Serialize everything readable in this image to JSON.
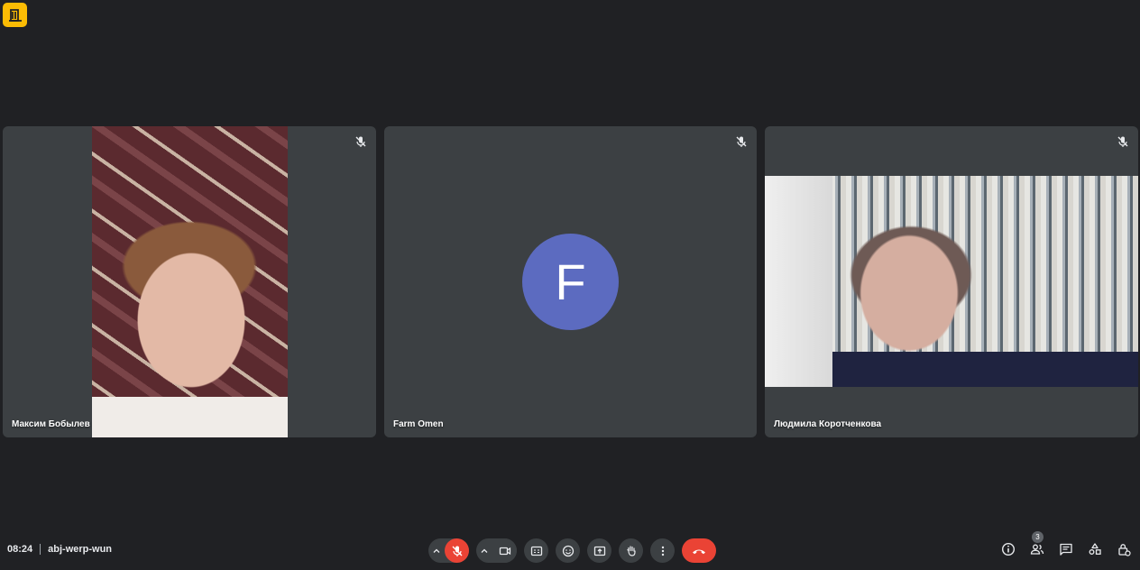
{
  "participants": [
    {
      "name": "Максим Бобылев",
      "mic": "muted"
    },
    {
      "name": "Farm Omen",
      "mic": "muted",
      "avatar_letter": "F",
      "avatar_color": "#5c6bc0"
    },
    {
      "name": "Людмила Коротченкова",
      "mic": "muted"
    }
  ],
  "meeting": {
    "time": "08:24",
    "code": "abj-werp-wun"
  },
  "toolbar": {
    "icons": [
      "chevron-up-icon",
      "mic-off-icon",
      "chevron-up-icon",
      "videocam-icon",
      "captions-icon",
      "emoji-icon",
      "present-icon",
      "raise-hand-icon",
      "more-options-icon",
      "hang-up-icon"
    ]
  },
  "right_panel": {
    "people_count": "3",
    "icons": [
      "info-icon",
      "people-icon",
      "chat-icon",
      "activities-icon",
      "host-controls-icon"
    ]
  },
  "colors": {
    "background": "#202124",
    "tile": "#3c4043",
    "accent_red": "#ea4335",
    "logo_yellow": "#fbbc04"
  }
}
